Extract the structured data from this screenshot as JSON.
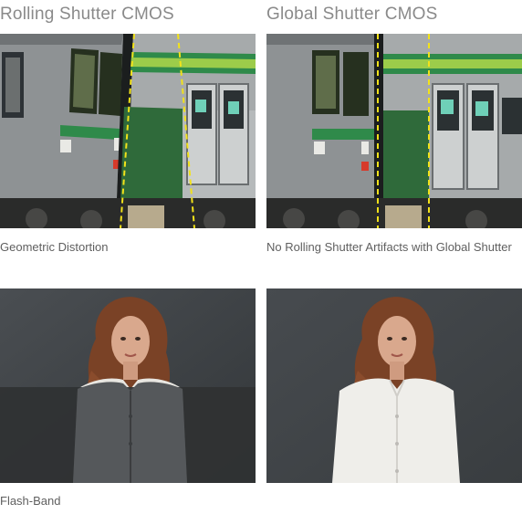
{
  "columns": [
    {
      "heading": "Rolling Shutter CMOS"
    },
    {
      "heading": "Global Shutter CMOS"
    }
  ],
  "rows": [
    {
      "captions": [
        "Geometric Distortion",
        "No Rolling Shutter Artifacts with Global Shutter"
      ],
      "subject": "train"
    },
    {
      "captions": [
        "Flash-Band",
        ""
      ],
      "subject": "portrait"
    }
  ],
  "colors": {
    "heading_text": "#8a8a8a",
    "caption_text": "#5f5f5f",
    "guide_line": "#f2e21a",
    "train_body": "#8e9294",
    "train_stripe_green": "#2f8a4a",
    "train_stripe_lime": "#9ccc4a",
    "backdrop_gray": "#3e4246",
    "shirt_white": "#efeeea",
    "shirt_dark": "#55585b",
    "hair": "#7a4226",
    "skin": "#d9a88d"
  }
}
